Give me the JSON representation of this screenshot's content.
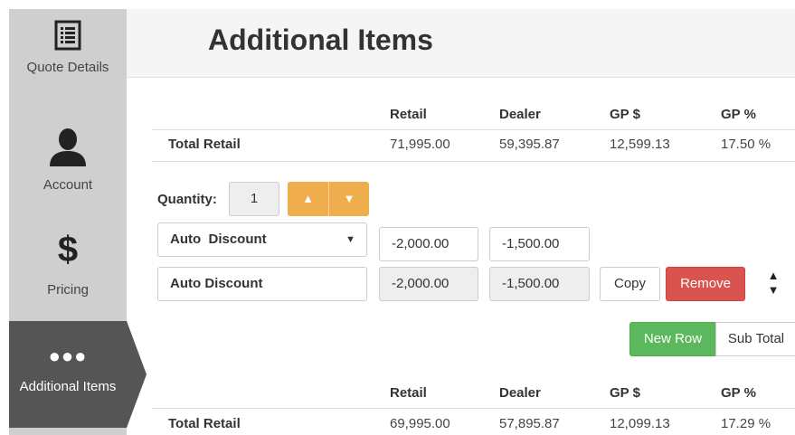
{
  "sidebar": {
    "items": [
      {
        "label": "Quote Details",
        "icon": "list-document-icon"
      },
      {
        "label": "Account",
        "icon": "user-icon"
      },
      {
        "label": "Pricing",
        "icon": "dollar-icon",
        "glyph": "$"
      },
      {
        "label": "Additional Items",
        "icon": "more-dots-icon",
        "glyph": "●●●",
        "active": true
      }
    ]
  },
  "header": {
    "title": "Additional Items"
  },
  "summary_top": {
    "headers": [
      "Retail",
      "Dealer",
      "GP $",
      "GP %"
    ],
    "row": {
      "label": "Total Retail",
      "values": [
        "71,995.00",
        "59,395.87",
        "12,599.13",
        "17.50 %"
      ]
    }
  },
  "quantity": {
    "label": "Quantity:",
    "value": "1",
    "up": "▲",
    "down": "▼"
  },
  "item_row_1": {
    "select_value": "Auto  Discount",
    "caret": "▼",
    "retail": "-2,000.00",
    "dealer": "-1,500.00"
  },
  "item_row_2": {
    "name": "Auto Discount",
    "retail": "-2,000.00",
    "dealer": "-1,500.00"
  },
  "actions": {
    "copy": "Copy",
    "remove": "Remove",
    "move_up": "▲",
    "move_down": "▼",
    "new_row": "New Row",
    "sub_total": "Sub Total"
  },
  "summary_bottom": {
    "headers": [
      "Retail",
      "Dealer",
      "GP $",
      "GP %"
    ],
    "row": {
      "label": "Total Retail",
      "values": [
        "69,995.00",
        "57,895.87",
        "12,099.13",
        "17.29 %"
      ]
    }
  },
  "colors": {
    "sidebar": "#cfcfcf",
    "active": "#555555",
    "warning": "#f0ad4e",
    "danger": "#d9534f",
    "success": "#5cb85c"
  }
}
